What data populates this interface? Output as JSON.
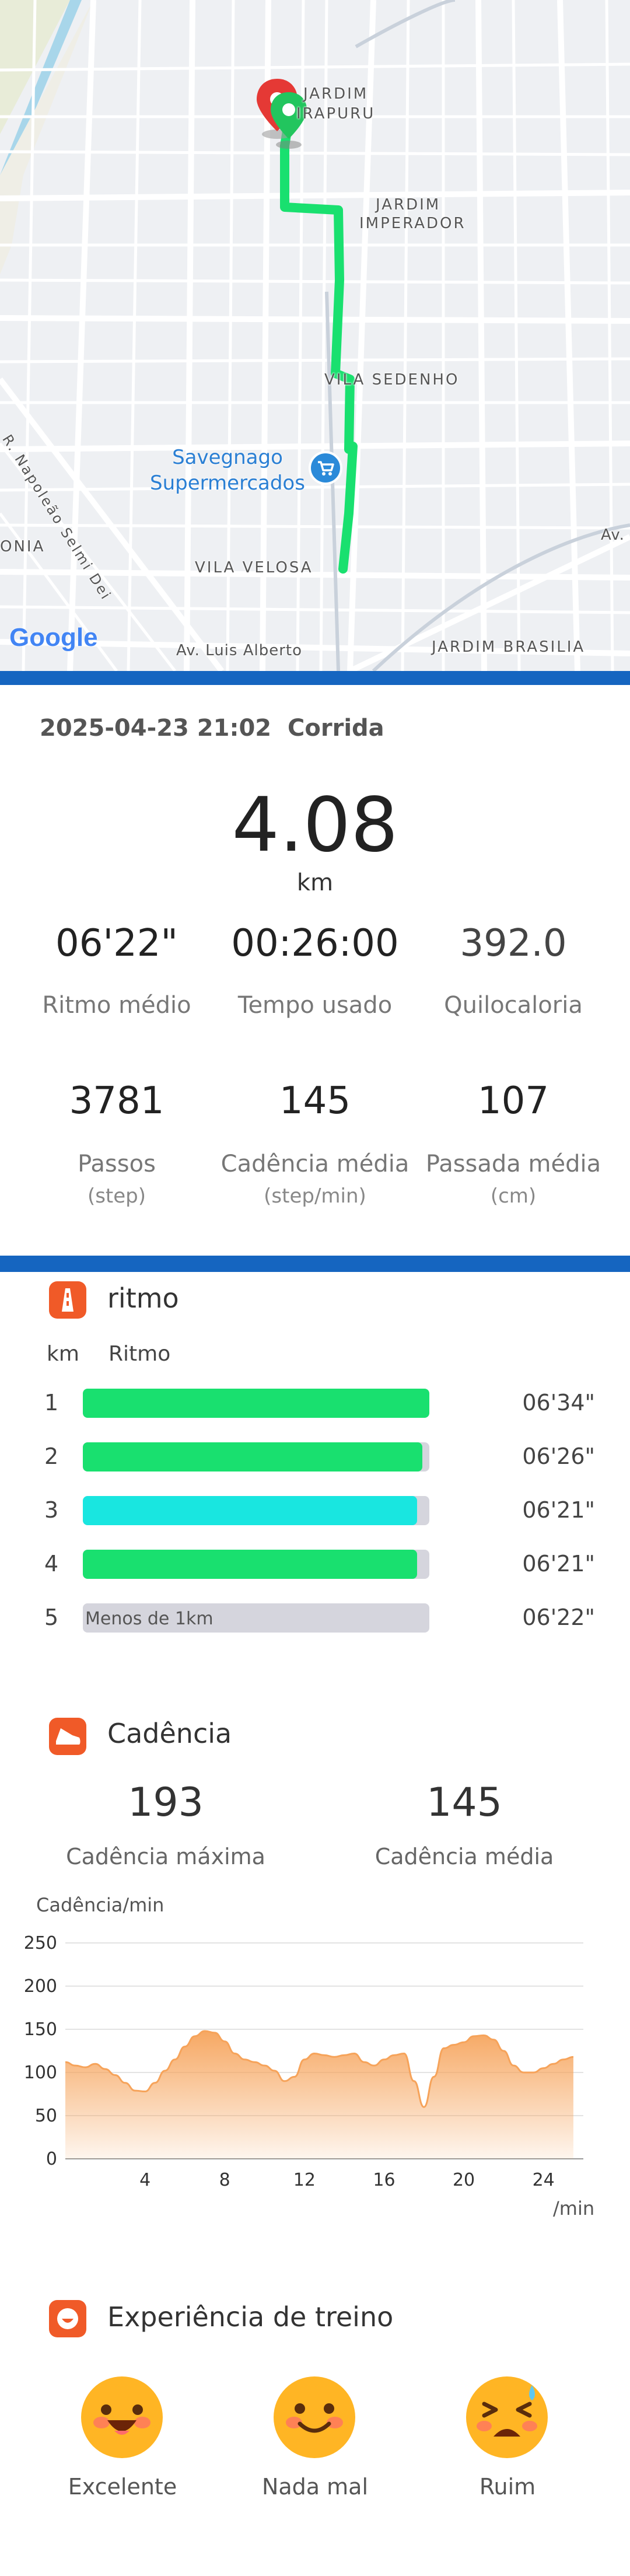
{
  "map": {
    "labels": {
      "jardim_irapuru_1": "JARDIM",
      "jardim_irapuru_2": "IRAPURU",
      "jardim_imperador_1": "JARDIM",
      "jardim_imperador_2": "IMPERADOR",
      "vila_sedenho": "VILA SEDENHO",
      "napoleao": "R. Napoleão Selmi Dei",
      "nia": "ONIA",
      "vila_velosa": "VILA VELOSA",
      "av_luis_alberto": "Av. Luis Alberto",
      "jardim_brasilia": "JARDIM BRASILIA",
      "av": "Av.",
      "poi_line1": "Savegnago",
      "poi_line2": "Supermercados"
    },
    "google_logo": "Google",
    "route_color": "#19e06f"
  },
  "header": {
    "datetime": "2025-04-23 21:02",
    "activity": "Corrida"
  },
  "summary": {
    "distance": "4.08",
    "distance_unit": "km",
    "stats_row1": [
      {
        "value": "06'22\"",
        "label": "Ritmo médio"
      },
      {
        "value": "00:26:00",
        "label": "Tempo usado"
      },
      {
        "value": "392.0",
        "label": "Quilocaloria"
      }
    ],
    "stats_row2": [
      {
        "value": "3781",
        "label": "Passos",
        "unit": "(step)"
      },
      {
        "value": "145",
        "label": "Cadência média",
        "unit": "(step/min)"
      },
      {
        "value": "107",
        "label": "Passada média",
        "unit": "(cm)"
      }
    ]
  },
  "pace": {
    "title": "ritmo",
    "col_km": "km",
    "col_pace": "Ritmo",
    "rows": [
      {
        "km": "1",
        "time": "06'34\"",
        "fill": 1.0,
        "color": "#19e06f",
        "note": ""
      },
      {
        "km": "2",
        "time": "06'26\"",
        "fill": 0.98,
        "color": "#19e06f",
        "note": ""
      },
      {
        "km": "3",
        "time": "06'21\"",
        "fill": 0.965,
        "color": "#19e6e0",
        "note": ""
      },
      {
        "km": "4",
        "time": "06'21\"",
        "fill": 0.965,
        "color": "#19e06f",
        "note": ""
      },
      {
        "km": "5",
        "time": "06'22\"",
        "fill": 0.0,
        "color": "#19e06f",
        "note": "Menos de 1km"
      }
    ]
  },
  "cadence": {
    "title": "Cadência",
    "max_value": "193",
    "max_label": "Cadência máxima",
    "avg_value": "145",
    "avg_label": "Cadência média"
  },
  "chart_data": {
    "type": "area",
    "ylabel": "Cadência/min",
    "xlabel": "/min",
    "ylim": [
      0,
      250
    ],
    "xlim": [
      0,
      26
    ],
    "yticks": [
      0,
      50,
      100,
      150,
      200,
      250
    ],
    "xticks": [
      4,
      8,
      12,
      16,
      20,
      24
    ],
    "grid": true,
    "color": "#f6a35a",
    "x": [
      0,
      0.5,
      1,
      1.5,
      2,
      2.5,
      3,
      3.5,
      4,
      4.5,
      5,
      5.5,
      6,
      6.5,
      7,
      7.5,
      8,
      8.5,
      9,
      9.5,
      10,
      10.5,
      11,
      11.5,
      12,
      12.5,
      13,
      13.5,
      14,
      14.5,
      15,
      15.5,
      16,
      16.5,
      17,
      17.5,
      18,
      18.5,
      19,
      19.5,
      20,
      20.5,
      21,
      21.5,
      22,
      22.5,
      23,
      23.5,
      24,
      24.5,
      25,
      25.5
    ],
    "values": [
      112,
      108,
      106,
      110,
      104,
      97,
      88,
      79,
      78,
      88,
      102,
      115,
      130,
      142,
      148,
      146,
      136,
      122,
      115,
      112,
      108,
      102,
      90,
      95,
      115,
      122,
      120,
      118,
      120,
      122,
      112,
      108,
      115,
      120,
      122,
      90,
      60,
      95,
      128,
      132,
      135,
      142,
      143,
      138,
      125,
      108,
      100,
      100,
      105,
      110,
      115,
      118
    ]
  },
  "experience": {
    "title": "Experiência de treino",
    "options": [
      {
        "label": "Excelente",
        "icon": "excellent-face-icon"
      },
      {
        "label": "Nada mal",
        "icon": "smile-face-icon"
      },
      {
        "label": "Ruim",
        "icon": "tired-face-icon"
      }
    ],
    "face_color": "#ffb524",
    "accent_color": "#f05a28",
    "bar_color": "#1565c0"
  }
}
